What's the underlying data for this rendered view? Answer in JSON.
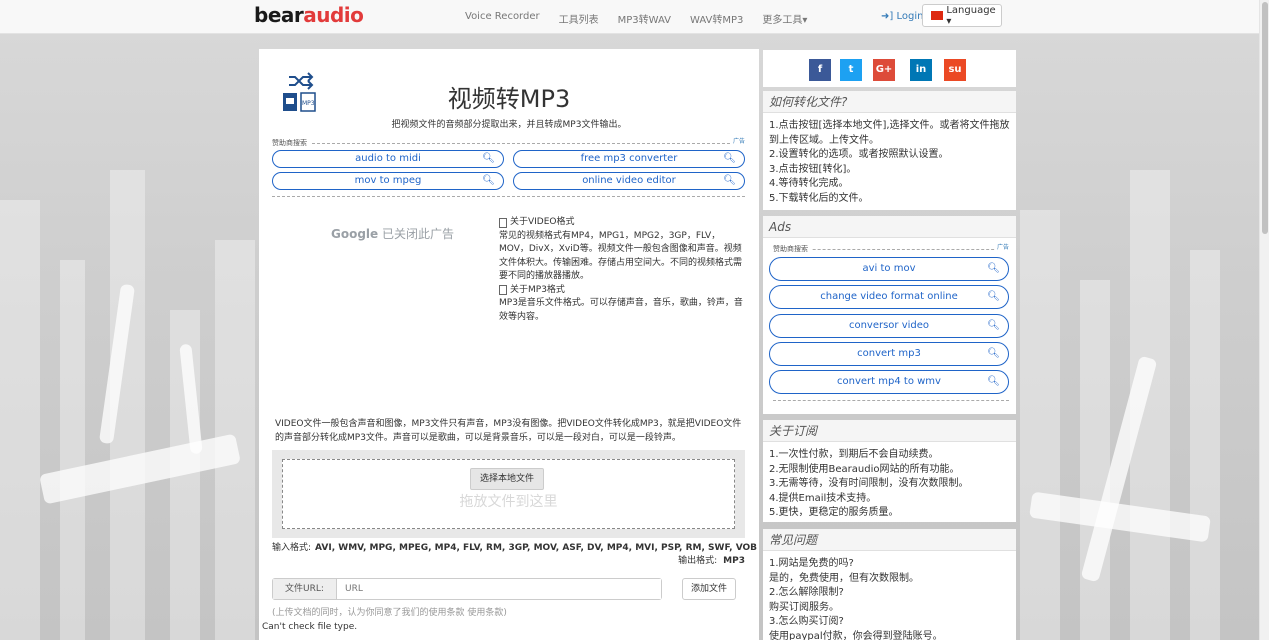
{
  "brand": {
    "logo_part1": "bear",
    "logo_part2": "audio"
  },
  "nav": {
    "links": [
      "Voice Recorder",
      "工具列表",
      "MP3转WAV",
      "WAV转MP3",
      "更多工具▾"
    ],
    "login": "Login",
    "language": "Language ▾"
  },
  "main": {
    "title": "视频转MP3",
    "subtitle": "把视频文件的音频部分提取出来，并且转成MP3文件输出。",
    "ads": {
      "label": "赞助商搜索",
      "ad_tag": "广告",
      "items": [
        "audio to midi",
        "free mp3 converter",
        "mov to mpeg",
        "online video editor"
      ]
    },
    "google_closed": {
      "brand": "Google",
      "text": "已关闭此广告"
    },
    "info": {
      "video_heading": "关于VIDEO格式",
      "video_text": "常见的视频格式有MP4，MPG1，MPG2，3GP，FLV，MOV，DivX，XviD等。视频文件一般包含图像和声音。视频文件体积大。传输困难。存储占用空间大。不同的视频格式需要不同的播放器播放。",
      "mp3_heading": "关于MP3格式",
      "mp3_text": "MP3是音乐文件格式。可以存储声音，音乐，歌曲，铃声，音效等内容。"
    },
    "description": "VIDEO文件一般包含声音和图像，MP3文件只有声音，MP3没有图像。把VIDEO文件转化成MP3，就是把VIDEO文件的声音部分转化成MP3文件。声音可以是歌曲，可以是背景音乐，可以是一段对白，可以是一段铃声。",
    "upload": {
      "choose_label": "选择本地文件",
      "drop_hint": "拖放文件到这里"
    },
    "input_formats_label": "输入格式:",
    "input_formats": "AVI, WMV, MPG, MPEG, MP4, FLV, RM, 3GP, MOV, ASF, DV, MP4, MVI, PSP, RM, SWF, VOB",
    "output_formats_label": "输出格式:",
    "output_formats": "MP3",
    "url": {
      "label": "文件URL:",
      "placeholder": "URL",
      "add_button": "添加文件"
    },
    "terms": "(上传文档的同时，认为你同意了我们的使用条款 使用条款)",
    "status": "Can't check file type."
  },
  "sidebar": {
    "social": [
      "f",
      "t",
      "G+",
      "in",
      "su"
    ],
    "social_colors": [
      "#3b5998",
      "#1da1f2",
      "#dd4b39",
      "#0077b5",
      "#eb4924"
    ],
    "howto": {
      "title": "如何转化文件?",
      "steps": [
        "1.点击按钮[选择本地文件],选择文件。或者将文件拖放到上传区域。上传文件。",
        "2.设置转化的选项。或者按照默认设置。",
        "3.点击按钮[转化]。",
        "4.等待转化完成。",
        "5.下载转化后的文件。"
      ]
    },
    "ads": {
      "title": "Ads",
      "label": "赞助商搜索",
      "ad_tag": "广告",
      "items": [
        "avi to mov",
        "change video format online",
        "conversor video",
        "convert mp3",
        "convert mp4 to wmv"
      ]
    },
    "subscription": {
      "title": "关于订阅",
      "items": [
        "1.一次性付款，到期后不会自动续费。",
        "2.无限制使用Bearaudio网站的所有功能。",
        "3.无需等待，没有时间限制，没有次数限制。",
        "4.提供Email技术支持。",
        "5.更快，更稳定的服务质量。"
      ]
    },
    "faq": {
      "title": "常见问题",
      "items": [
        "1.网站是免费的吗?",
        "是的，免费使用，但有次数限制。",
        "2.怎么解除限制?",
        "购买订阅服务。",
        "3.怎么购买订阅?",
        "使用paypal付款，你会得到登陆账号。"
      ]
    }
  }
}
